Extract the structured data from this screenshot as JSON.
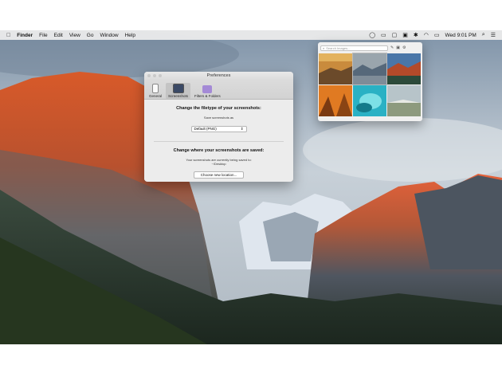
{
  "menubar": {
    "apple_icon": "apple-icon",
    "app_name": "Finder",
    "items": [
      "File",
      "Edit",
      "View",
      "Go",
      "Window",
      "Help"
    ],
    "clock": "Wed 9:01 PM"
  },
  "prefs": {
    "title": "Preferences",
    "tabs": [
      {
        "label": "General",
        "icon": "phone-icon"
      },
      {
        "label": "Screenshots",
        "icon": "screen-icon"
      },
      {
        "label": "Filters & Folders",
        "icon": "folder-icon"
      }
    ],
    "section1_title": "Change the filetype of your screenshots:",
    "save_as_label": "Save screenshots as",
    "filetype_value": "Default (PNG)",
    "section2_title": "Change where your screenshots are saved:",
    "current_location_line1": "Your screenshots are currently being saved to:",
    "current_location_line2": "~/Desktop",
    "choose_button": "Choose new location..."
  },
  "panel": {
    "search_placeholder": "Search Images..."
  },
  "colors": {
    "menubar_bg": "#ececec",
    "window_bg": "#ececec",
    "accent": "#c4c4c4"
  }
}
